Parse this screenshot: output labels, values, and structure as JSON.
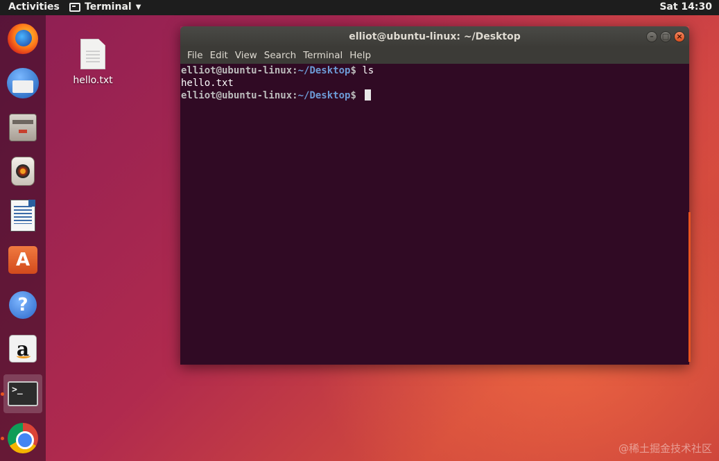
{
  "topbar": {
    "activities": "Activities",
    "app_name": "Terminal",
    "clock": "Sat 14:30"
  },
  "dock": {
    "items": [
      {
        "name": "firefox",
        "icon": "firefox-icon"
      },
      {
        "name": "thunderbird",
        "icon": "thunderbird-icon"
      },
      {
        "name": "files",
        "icon": "files-icon"
      },
      {
        "name": "rhythmbox",
        "icon": "rhythmbox-icon"
      },
      {
        "name": "libreoffice-writer",
        "icon": "writer-icon"
      },
      {
        "name": "ubuntu-software",
        "icon": "software-icon",
        "glyph": "A"
      },
      {
        "name": "help",
        "icon": "help-icon",
        "glyph": "?"
      },
      {
        "name": "amazon",
        "icon": "amazon-icon",
        "glyph": "a"
      },
      {
        "name": "terminal",
        "icon": "terminal-icon",
        "glyph": ">_",
        "active": true
      },
      {
        "name": "chrome",
        "icon": "chrome-icon"
      }
    ]
  },
  "desktop": {
    "file_label": "hello.txt"
  },
  "terminal": {
    "title": "elliot@ubuntu-linux: ~/Desktop",
    "menu": [
      "File",
      "Edit",
      "View",
      "Search",
      "Terminal",
      "Help"
    ],
    "lines": [
      {
        "user": "elliot@ubuntu-linux",
        "sep": ":",
        "path": "~/Desktop",
        "sym": "$",
        "cmd": " ls"
      },
      {
        "output": "hello.txt"
      },
      {
        "user": "elliot@ubuntu-linux",
        "sep": ":",
        "path": "~/Desktop",
        "sym": "$",
        "cmd": " "
      }
    ]
  },
  "watermark": "@稀土掘金技术社区",
  "colors": {
    "accent": "#e95420",
    "terminal_bg": "#300a24",
    "path_blue": "#6d9bd6"
  }
}
